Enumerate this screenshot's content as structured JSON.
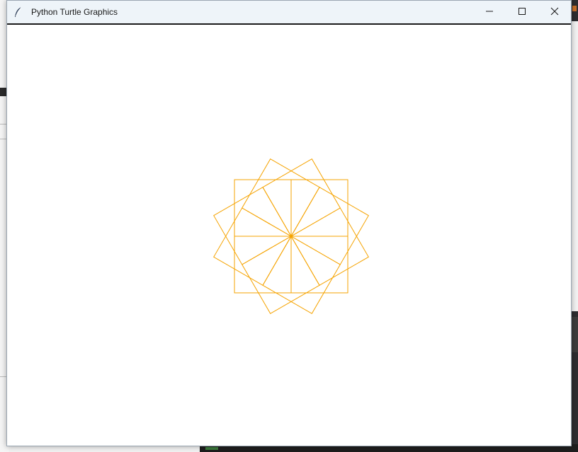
{
  "window": {
    "title": "Python Turtle Graphics",
    "app_icon": "feather-icon",
    "controls": {
      "minimize_icon": "minimize-icon",
      "maximize_icon": "maximize-icon",
      "close_icon": "close-icon"
    }
  },
  "drawing": {
    "shape": "square",
    "count": 12,
    "rotation_step_deg": 30,
    "stroke_color": "#f5a300",
    "background": "#ffffff"
  },
  "colors": {
    "titlebar_bg": "#eef4f9",
    "title_text": "#1a1a1a",
    "pen": "#f5a300"
  }
}
